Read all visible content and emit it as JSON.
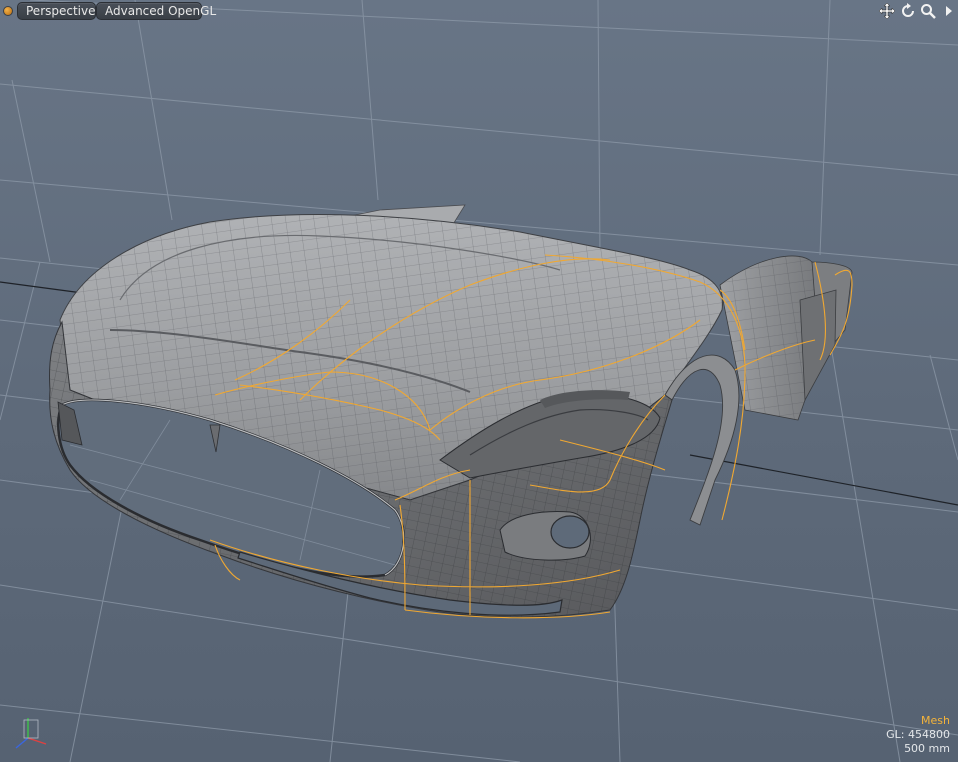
{
  "toolbar": {
    "view_mode": "Perspective",
    "render_mode": "Advanced OpenGL",
    "icons": [
      "move-view-icon",
      "rotate-view-icon",
      "zoom-view-icon",
      "more-options-icon"
    ]
  },
  "hud": {
    "selection_mode": "Mesh",
    "gl_polygons": "GL: 454800",
    "grid_scale": "500 mm"
  },
  "colors": {
    "accent_selection": "#f5b43a",
    "background": "#5f6b7b",
    "mesh_surface": "#9a9c9f",
    "grid_line": "#8d99a8"
  }
}
